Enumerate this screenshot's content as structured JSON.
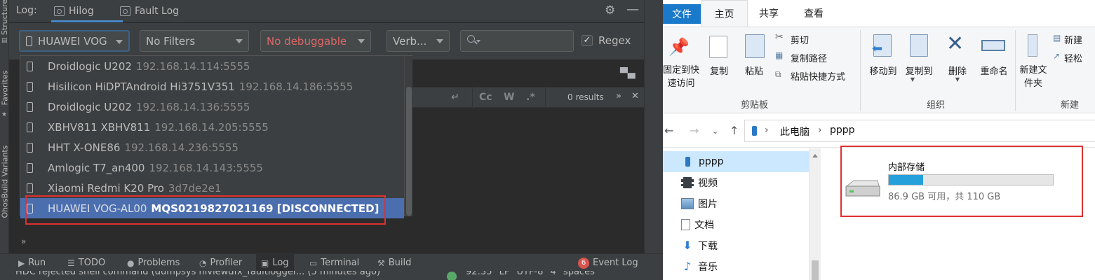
{
  "ide": {
    "side_tabs": [
      "Structure",
      "Favorites",
      "OhosBuild Variants"
    ],
    "header": {
      "log_label": "Log:",
      "tabs": [
        "Hilog",
        "Fault Log"
      ]
    },
    "toolbar": {
      "device": "HUAWEI VOG",
      "filter": "No Filters",
      "debuggable": "No debuggable",
      "level": "Verb...",
      "search_placeholder": "",
      "regex_label": "Regex",
      "regex_checked": true
    },
    "find_bar": {
      "results": "0 results",
      "toggles": [
        "Cc",
        "W",
        ".*"
      ]
    },
    "device_list": [
      {
        "name": "Droidlogic U202",
        "serial": "192.168.14.114:5555",
        "selected": false
      },
      {
        "name": "Hisilicon HiDPTAndroid Hi3751V351",
        "serial": "192.168.14.186:5555",
        "selected": false
      },
      {
        "name": "Droidlogic U202",
        "serial": "192.168.14.136:5555",
        "selected": false
      },
      {
        "name": "XBHV811 XBHV811",
        "serial": "192.168.14.205:5555",
        "selected": false
      },
      {
        "name": "HHT X-ONE86",
        "serial": "192.168.14.236:5555",
        "selected": false
      },
      {
        "name": "Amlogic T7_an400",
        "serial": "192.168.14.143:5555",
        "selected": false
      },
      {
        "name": "Xiaomi Redmi K20 Pro",
        "serial": "3d7de2e1",
        "selected": false
      },
      {
        "name": "HUAWEI VOG-AL00",
        "serial": "MQS0219827021169 [DISCONNECTED]",
        "selected": true
      }
    ],
    "more_label": "»",
    "tool_tabs": {
      "run": "Run",
      "todo": "TODO",
      "problems": "Problems",
      "profiler": "Profiler",
      "log": "Log",
      "terminal": "Terminal",
      "build": "Build",
      "event_log": "Event Log",
      "event_count": "6"
    },
    "status": {
      "message": "HDC rejected shell command (dumpsys hiviewdfx_faultlogger... (5 minutes ago)",
      "position": "92:35",
      "line_ending": "LF",
      "encoding": "UTF-8",
      "indent": "4 spaces"
    }
  },
  "explorer": {
    "ribbon_tabs": [
      "文件",
      "主页",
      "共享",
      "查看"
    ],
    "clipboard": {
      "pin": "固定到快速访问",
      "copy": "复制",
      "paste": "粘贴",
      "cut": "剪切",
      "copy_path": "复制路径",
      "paste_shortcut": "粘贴快捷方式",
      "group": "剪贴板"
    },
    "organize": {
      "move_to": "移动到",
      "copy_to": "复制到",
      "delete": "删除",
      "rename": "重命名",
      "group": "组织"
    },
    "new": {
      "new_folder": "新建文件夹",
      "new_item": "新建",
      "easy_access": "轻松",
      "group": "新建"
    },
    "breadcrumb": [
      "此电脑",
      "pppp"
    ],
    "nav_items": [
      "pppp",
      "视频",
      "图片",
      "文档",
      "下载",
      "音乐"
    ],
    "drive": {
      "name": "内部存储",
      "free_text": "86.9 GB 可用，共 110 GB",
      "used_fraction": 0.21,
      "bar_color": "#26a0da"
    }
  }
}
